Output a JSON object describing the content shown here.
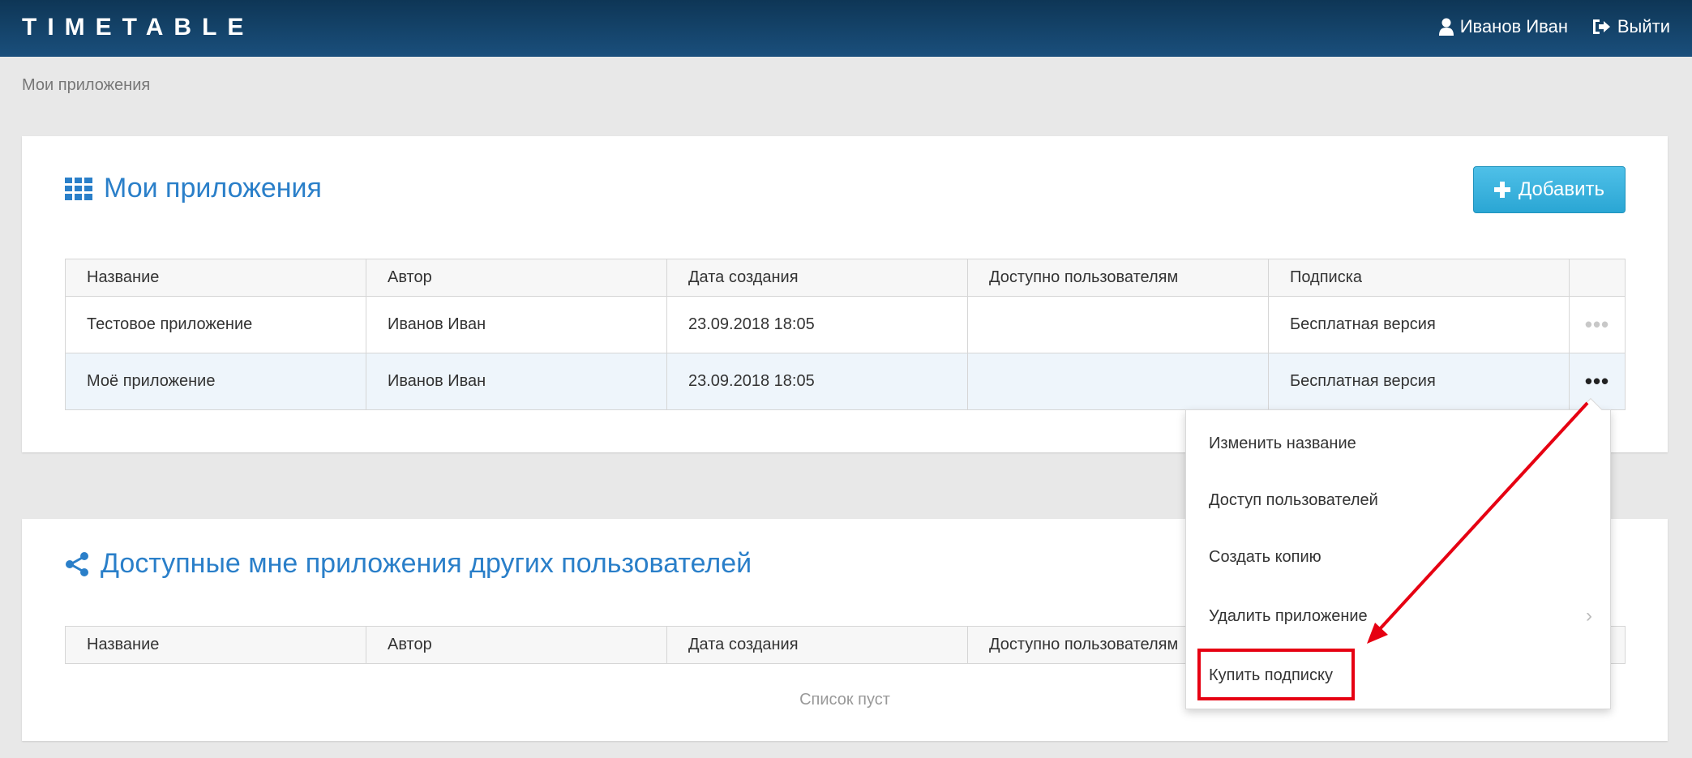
{
  "header": {
    "logo": "TIMETABLE",
    "user": "Иванов Иван",
    "logout": "Выйти"
  },
  "breadcrumb": "Мои приложения",
  "my_apps": {
    "title": "Мои приложения",
    "add_label": "Добавить",
    "columns": [
      "Название",
      "Автор",
      "Дата создания",
      "Доступно пользователям",
      "Подписка"
    ],
    "rows": [
      {
        "name": "Тестовое приложение",
        "author": "Иванов Иван",
        "created": "23.09.2018 18:05",
        "shared": "",
        "subscription": "Бесплатная версия"
      },
      {
        "name": "Моё приложение",
        "author": "Иванов Иван",
        "created": "23.09.2018 18:05",
        "shared": "",
        "subscription": "Бесплатная версия"
      }
    ]
  },
  "shared_apps": {
    "title": "Доступные мне приложения других пользователей",
    "columns": [
      "Название",
      "Автор",
      "Дата создания",
      "Доступно пользователям"
    ],
    "empty": "Список пуст"
  },
  "context_menu": {
    "items": [
      "Изменить название",
      "Доступ пользователей",
      "Создать копию",
      "Удалить приложение",
      "Купить подписку"
    ],
    "highlighted_item": "Купить подписку"
  },
  "colors": {
    "accent": "#2a7fc9",
    "topbar": "#123f66",
    "highlight": "#e60012"
  }
}
